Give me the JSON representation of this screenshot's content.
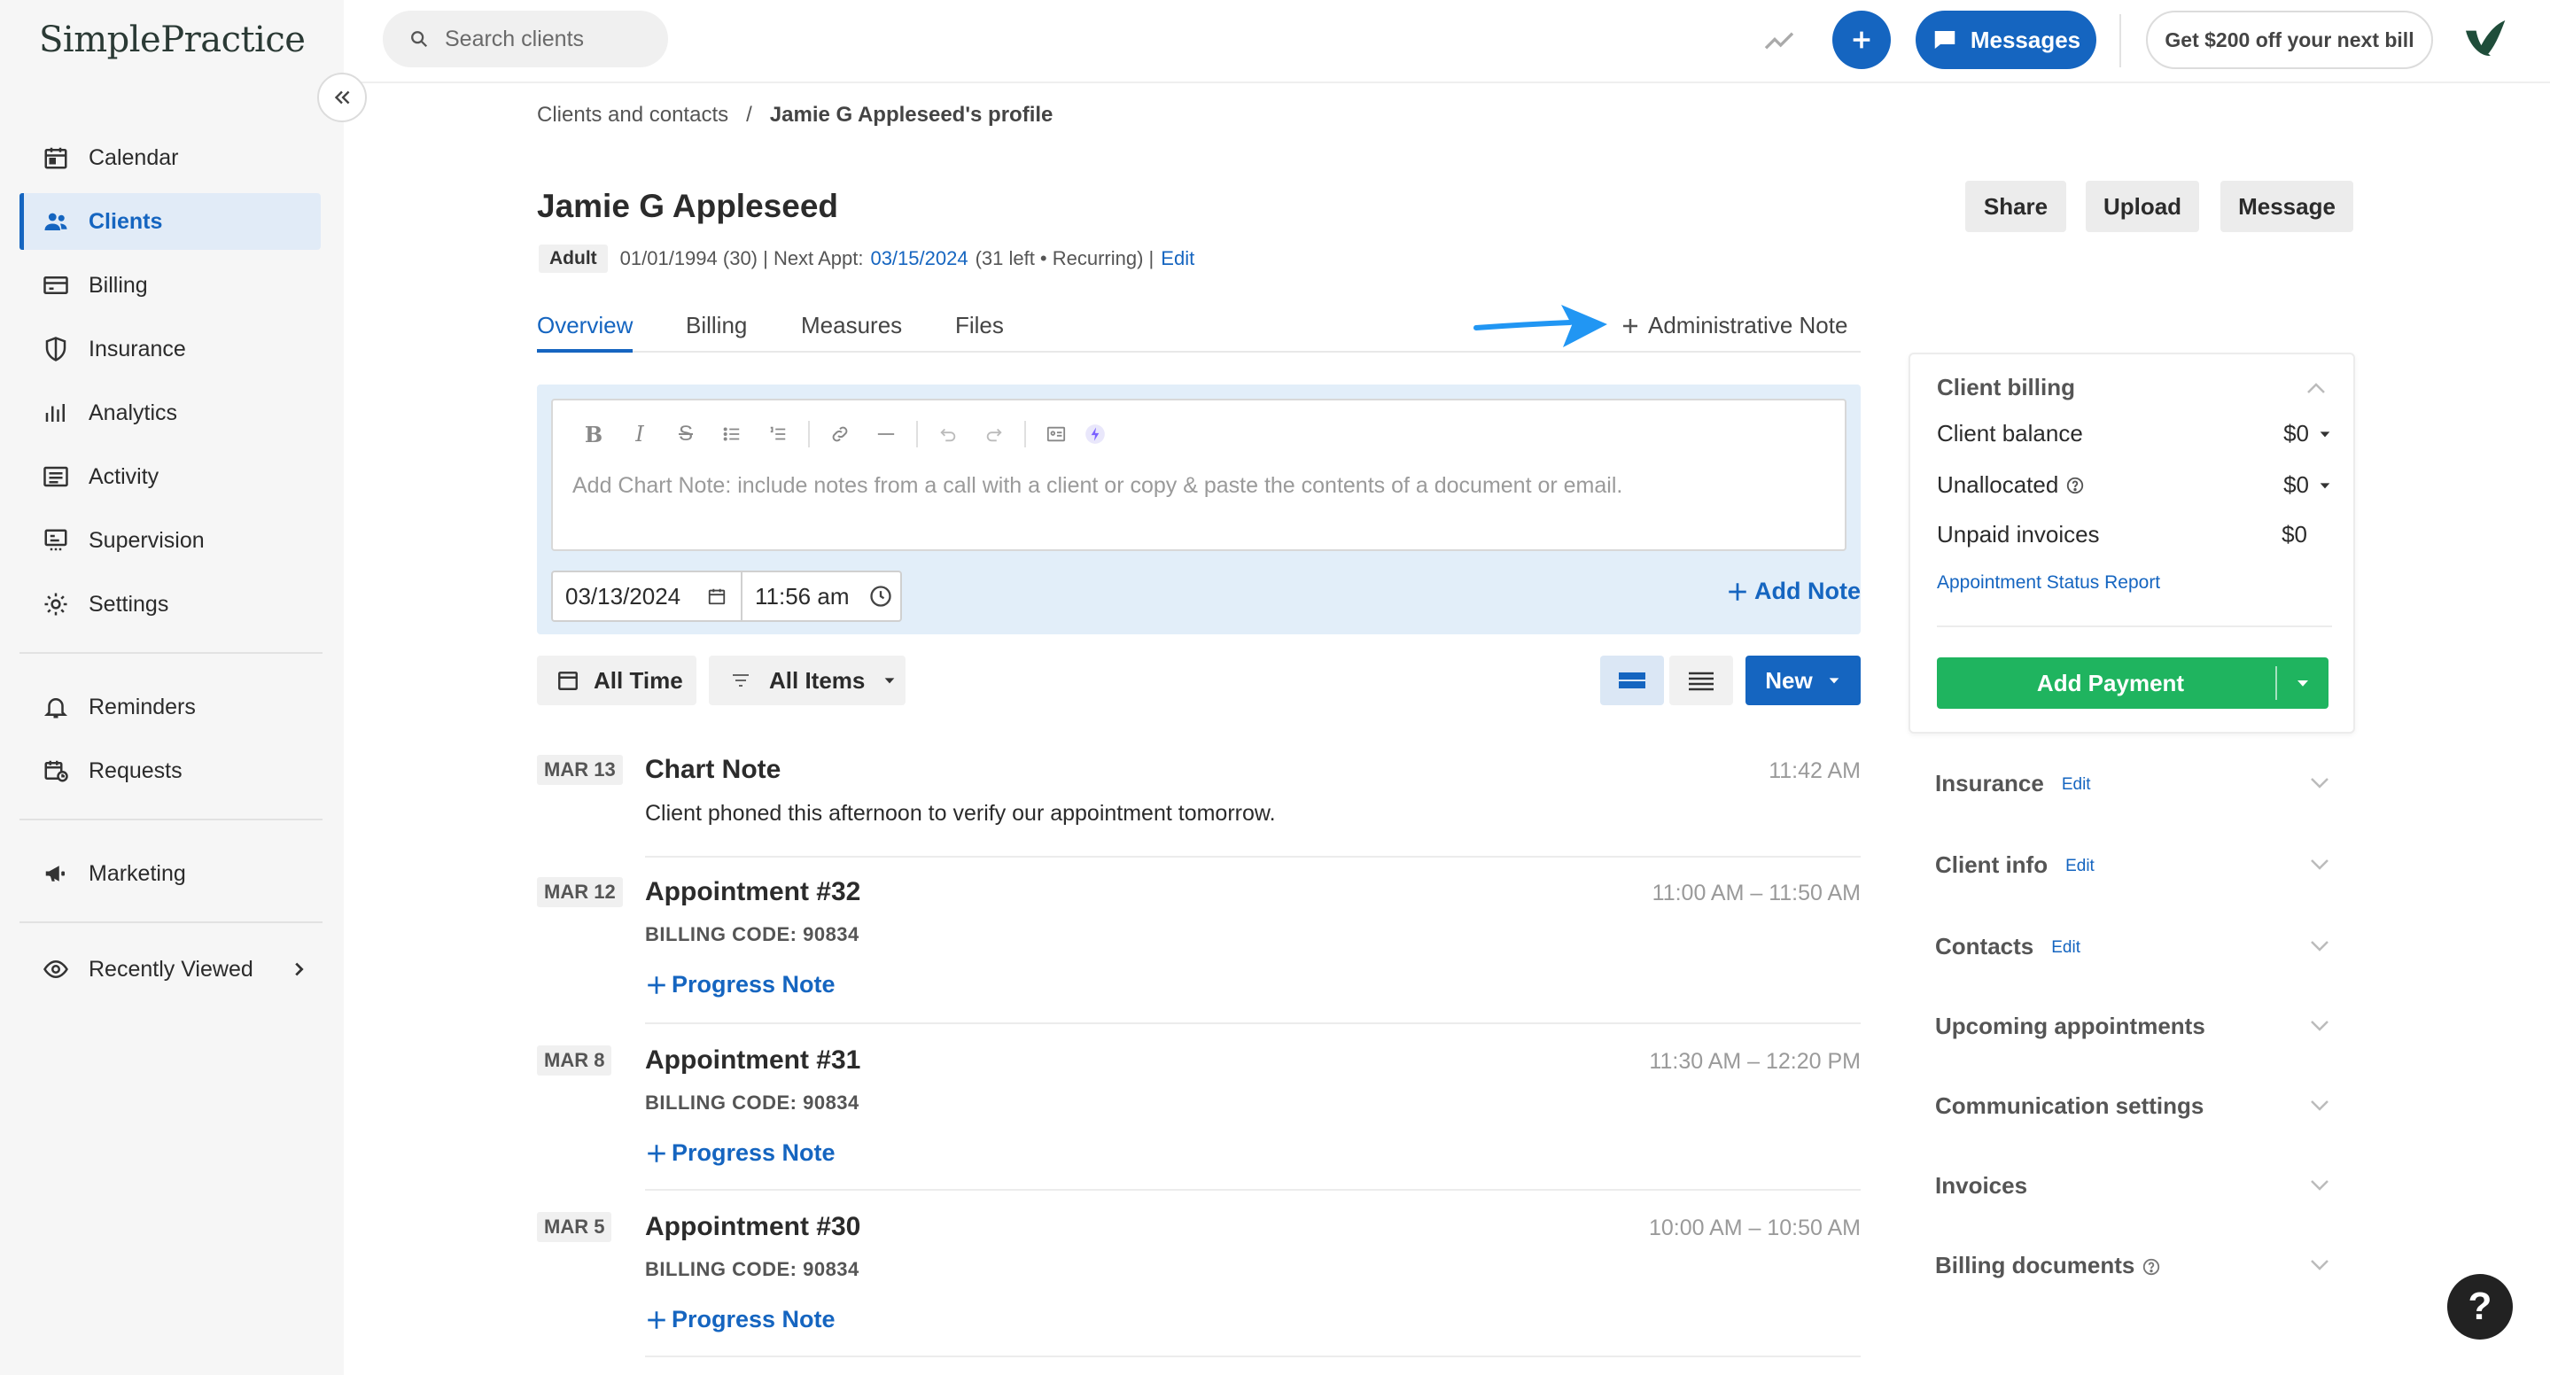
{
  "app": {
    "logo": "SimplePractice"
  },
  "sidebar": {
    "items": [
      {
        "label": "Calendar",
        "icon": "calendar-icon"
      },
      {
        "label": "Clients",
        "icon": "clients-icon",
        "active": true
      },
      {
        "label": "Billing",
        "icon": "billing-icon"
      },
      {
        "label": "Insurance",
        "icon": "shield-icon"
      },
      {
        "label": "Analytics",
        "icon": "analytics-icon"
      },
      {
        "label": "Activity",
        "icon": "activity-icon"
      },
      {
        "label": "Supervision",
        "icon": "supervision-icon"
      },
      {
        "label": "Settings",
        "icon": "gear-icon"
      }
    ],
    "secondary": [
      {
        "label": "Reminders",
        "icon": "bell-icon"
      },
      {
        "label": "Requests",
        "icon": "requests-icon"
      }
    ],
    "tertiary": [
      {
        "label": "Marketing",
        "icon": "megaphone-icon"
      }
    ],
    "recent": {
      "label": "Recently Viewed",
      "icon": "eye-icon"
    }
  },
  "topbar": {
    "search_placeholder": "Search clients",
    "messages_label": "Messages",
    "promo_label": "Get $200 off your next bill"
  },
  "breadcrumb": {
    "parent": "Clients and contacts",
    "separator": "/",
    "current": "Jamie G Appleseed's profile"
  },
  "client": {
    "name": "Jamie G Appleseed",
    "badge": "Adult",
    "dob": "01/01/1994 (30) | Next Appt:",
    "next_appt": "03/15/2024",
    "appt_meta": "(31 left • Recurring) |",
    "edit_label": "Edit"
  },
  "actions": {
    "share": "Share",
    "upload": "Upload",
    "message": "Message"
  },
  "tabs": [
    "Overview",
    "Billing",
    "Measures",
    "Files"
  ],
  "admin_note_label": "Administrative Note",
  "note_editor": {
    "placeholder": "Add Chart Note: include notes from a call with a client or copy & paste the contents of a document or email.",
    "date": "03/13/2024",
    "time": "11:56 am",
    "add_label": "Add Note"
  },
  "filters": {
    "time": "All Time",
    "items": "All Items",
    "new_label": "New"
  },
  "timeline": [
    {
      "date": "MAR 13",
      "title": "Chart Note",
      "time": "11:42 AM",
      "body": "Client phoned this afternoon to verify our appointment tomorrow."
    },
    {
      "date": "MAR 12",
      "title": "Appointment #32",
      "time": "11:00 AM – 11:50 AM",
      "code": "BILLING CODE: 90834",
      "action": "Progress Note"
    },
    {
      "date": "MAR 8",
      "title": "Appointment #31",
      "time": "11:30 AM – 12:20 PM",
      "code": "BILLING CODE: 90834",
      "action": "Progress Note"
    },
    {
      "date": "MAR 5",
      "title": "Appointment #30",
      "time": "10:00 AM – 10:50 AM",
      "code": "BILLING CODE: 90834",
      "action": "Progress Note"
    }
  ],
  "billing": {
    "title": "Client billing",
    "rows": [
      {
        "label": "Client balance",
        "value": "$0"
      },
      {
        "label": "Unallocated",
        "value": "$0"
      },
      {
        "label": "Unpaid invoices",
        "value": "$0"
      }
    ],
    "report_link": "Appointment Status Report",
    "add_payment": "Add Payment"
  },
  "sections": [
    {
      "title": "Insurance",
      "edit": "Edit"
    },
    {
      "title": "Client info",
      "edit": "Edit"
    },
    {
      "title": "Contacts",
      "edit": "Edit"
    },
    {
      "title": "Upcoming appointments"
    },
    {
      "title": "Communication settings"
    },
    {
      "title": "Invoices"
    },
    {
      "title": "Billing documents"
    }
  ],
  "help_label": "?",
  "colors": {
    "accent": "#1565c0",
    "success": "#1fb45f",
    "sidebar_bg": "#f6f6f6"
  }
}
